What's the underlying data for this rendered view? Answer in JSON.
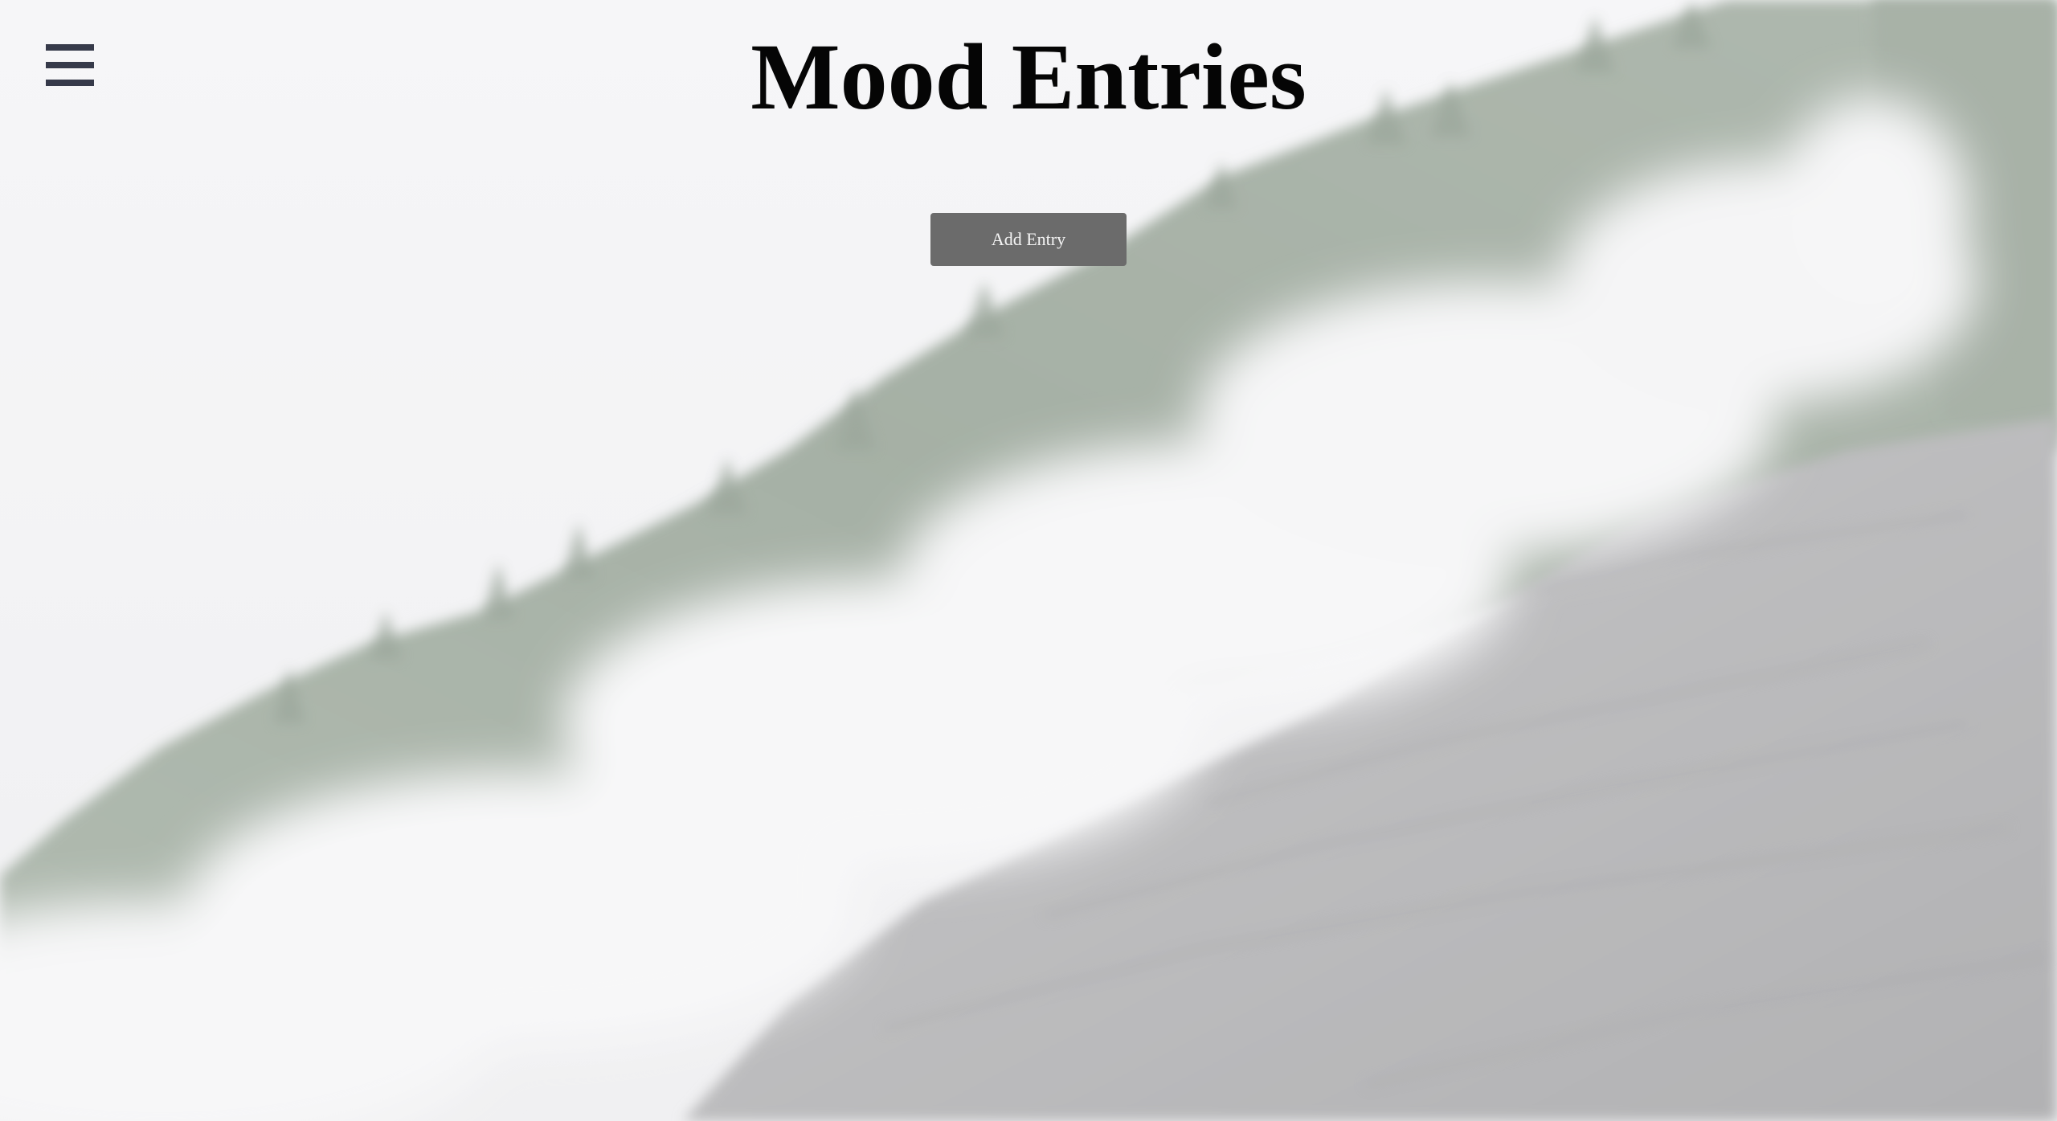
{
  "header": {
    "title": "Mood Entries",
    "menu_icon": "hamburger-menu-icon"
  },
  "main": {
    "add_entry_label": "Add Entry"
  },
  "colors": {
    "title": "#050505",
    "menu_icon": "#363a4a",
    "button_bg": "#6b6b6b",
    "button_text": "#f4f4f4",
    "background_haze": "#f3f3f4"
  }
}
